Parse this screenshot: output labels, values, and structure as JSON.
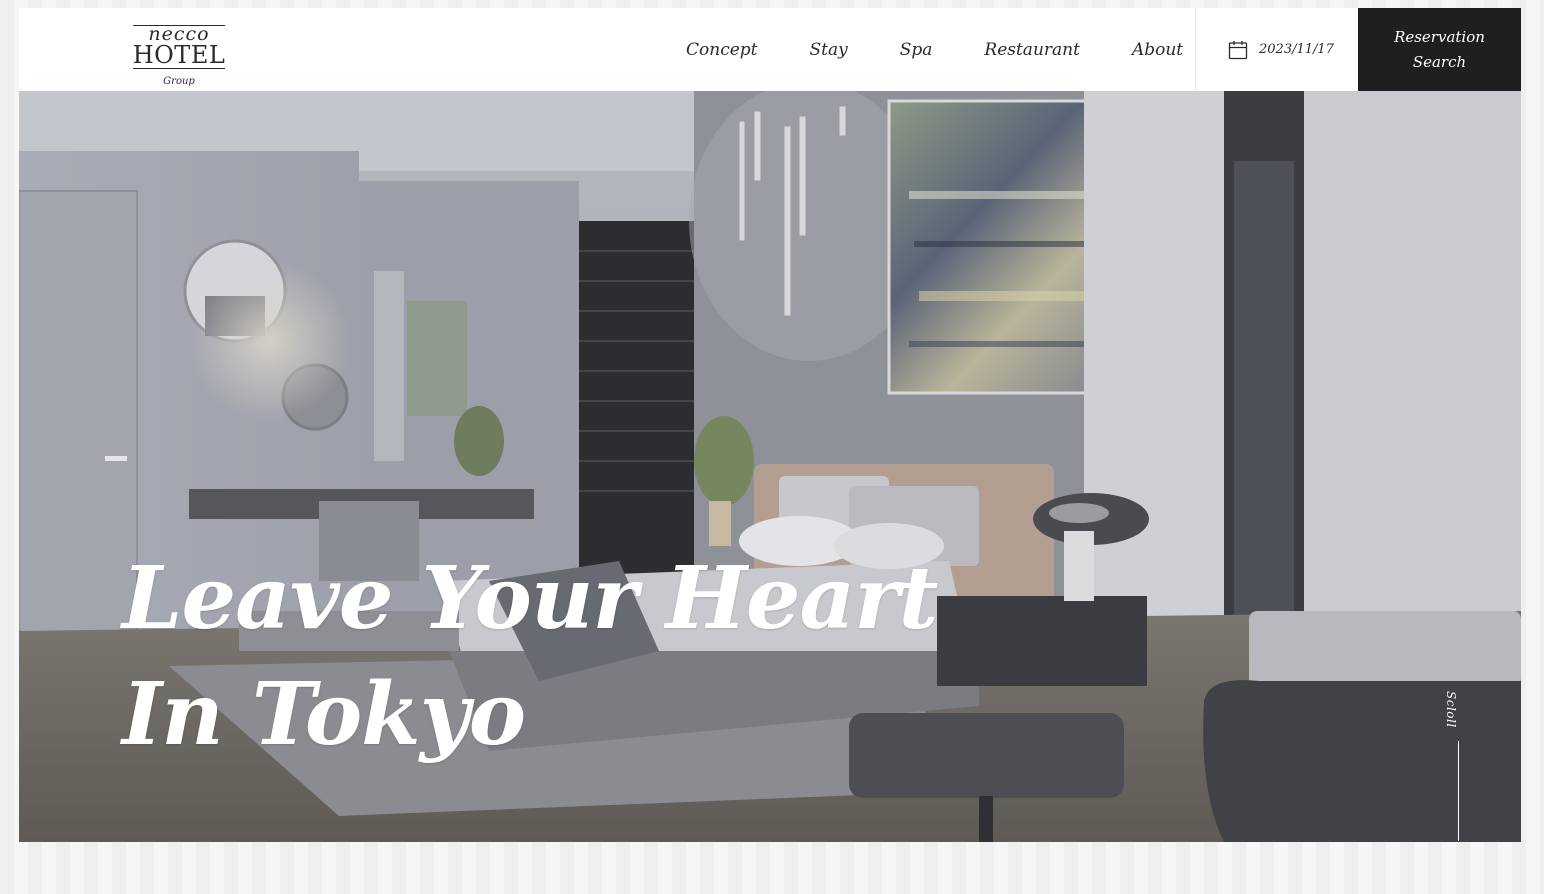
{
  "brand": {
    "logo_top": "necco",
    "logo_main": "HOTEL",
    "logo_sub": "Group"
  },
  "nav": {
    "items": [
      {
        "label": "Concept"
      },
      {
        "label": "Stay"
      },
      {
        "label": "Spa"
      },
      {
        "label": "Restaurant"
      },
      {
        "label": "About"
      }
    ]
  },
  "booking": {
    "date": "2023/11/17",
    "date_icon": "calendar-icon",
    "reserve_line1": "Reservation",
    "reserve_line2": "Search"
  },
  "hero": {
    "headline_line1": "Leave Your Heart",
    "headline_line2": "In Tokyo",
    "scroll_label": "Scloll",
    "image_subject": "modern grey hotel bedroom"
  },
  "colors": {
    "button_bg": "#1f1f1f",
    "text": "#2a2a2a",
    "headline": "#ffffff"
  }
}
